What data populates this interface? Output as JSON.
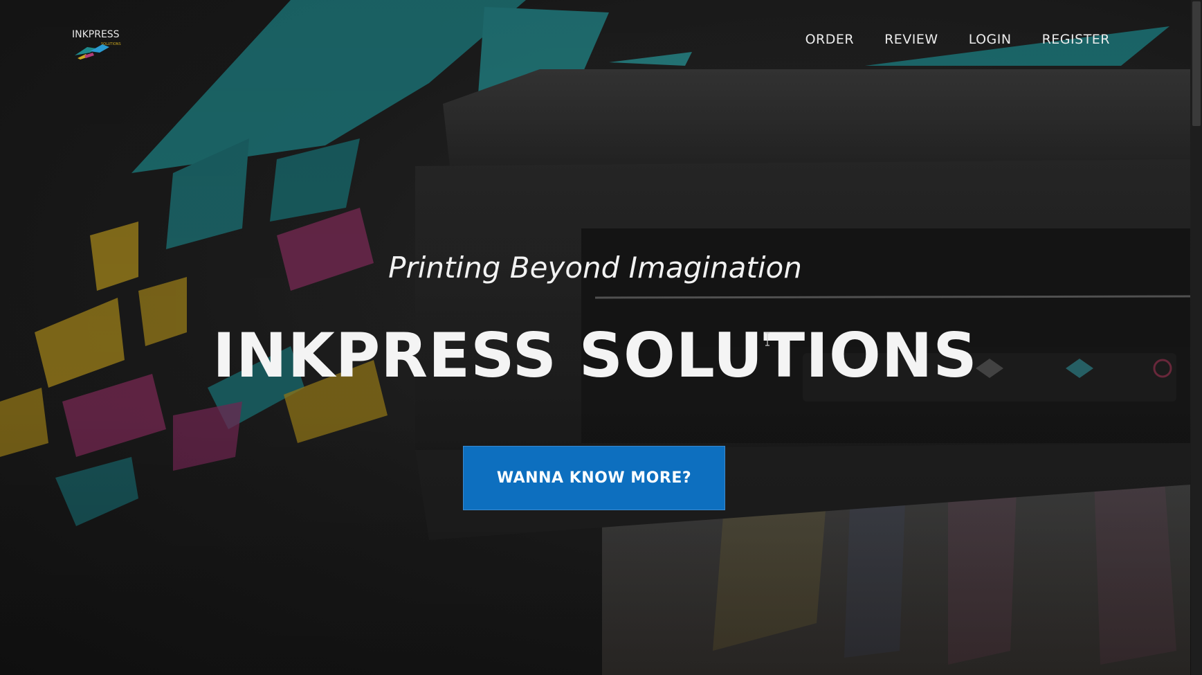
{
  "logo": {
    "text": "INKPRESS",
    "subtext": "SOLUTIONS"
  },
  "nav": {
    "items": [
      {
        "label": "ORDER"
      },
      {
        "label": "REVIEW"
      },
      {
        "label": "LOGIN"
      },
      {
        "label": "REGISTER"
      }
    ]
  },
  "hero": {
    "tagline": "Printing Beyond Imagination",
    "headline": "INKPRESS SOLUTIONS",
    "cta_label": "WANNA KNOW MORE?",
    "background": "printer-with-flying-paper-image"
  },
  "colors": {
    "cta": "#0d6fbf",
    "teal": "#1f8a8c",
    "yellow": "#c9a61f",
    "magenta": "#b13c78"
  }
}
